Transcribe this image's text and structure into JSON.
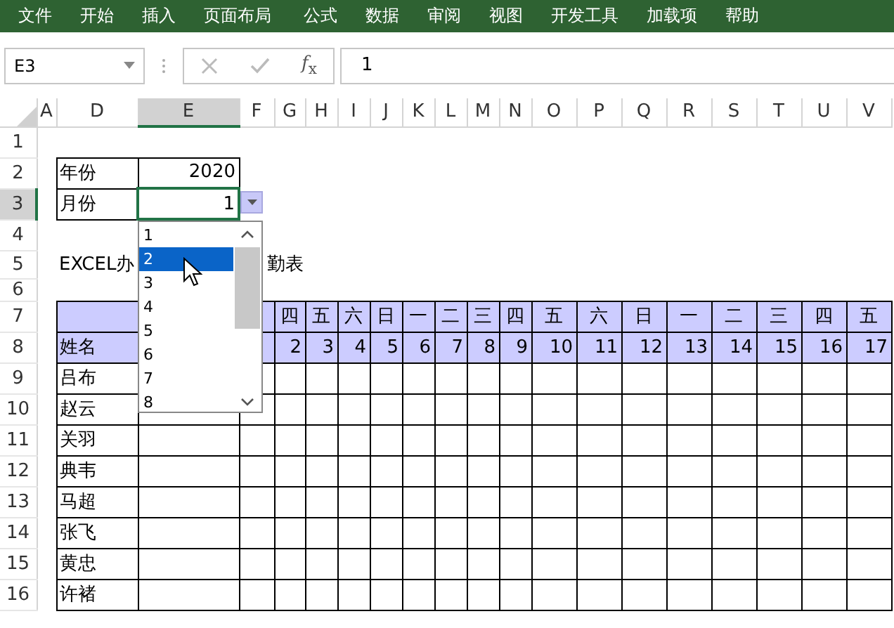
{
  "menu": [
    "文件",
    "开始",
    "插入",
    "页面布局",
    "公式",
    "数据",
    "审阅",
    "视图",
    "开发工具",
    "加载项",
    "帮助"
  ],
  "name_box": "E3",
  "fx_label": "*f*$_{x}$",
  "formula": "1",
  "columns": [
    {
      "label": "A",
      "selected": false
    },
    {
      "label": "D",
      "selected": false
    },
    {
      "label": "E",
      "selected": true
    },
    {
      "label": "F",
      "selected": false
    },
    {
      "label": "G",
      "selected": false
    },
    {
      "label": "H",
      "selected": false
    },
    {
      "label": "I",
      "selected": false
    },
    {
      "label": "J",
      "selected": false
    },
    {
      "label": "K",
      "selected": false
    },
    {
      "label": "L",
      "selected": false
    },
    {
      "label": "M",
      "selected": false
    },
    {
      "label": "N",
      "selected": false
    },
    {
      "label": "O",
      "selected": false
    },
    {
      "label": "P",
      "selected": false
    },
    {
      "label": "Q",
      "selected": false
    },
    {
      "label": "R",
      "selected": false
    },
    {
      "label": "S",
      "selected": false
    },
    {
      "label": "T",
      "selected": false
    },
    {
      "label": "U",
      "selected": false
    },
    {
      "label": "V",
      "selected": false
    }
  ],
  "rows": [
    {
      "label": "1",
      "selected": false
    },
    {
      "label": "2",
      "selected": false
    },
    {
      "label": "3",
      "selected": true
    },
    {
      "label": "4",
      "selected": false
    },
    {
      "label": "5",
      "selected": false
    },
    {
      "label": "6",
      "selected": false
    },
    {
      "label": "7",
      "selected": false
    },
    {
      "label": "8",
      "selected": false
    },
    {
      "label": "9",
      "selected": false
    },
    {
      "label": "10",
      "selected": false
    },
    {
      "label": "11",
      "selected": false
    },
    {
      "label": "12",
      "selected": false
    },
    {
      "label": "13",
      "selected": false
    },
    {
      "label": "14",
      "selected": false
    },
    {
      "label": "15",
      "selected": false
    },
    {
      "label": "16",
      "selected": false
    }
  ],
  "year_label": "年份",
  "year": "2020",
  "month_label": "月份",
  "month": "1",
  "title_parts": [
    "EXCEL办",
    "勤表"
  ],
  "weekdays": [
    "四",
    "五",
    "六",
    "日",
    "一",
    "二",
    "三",
    "四",
    "五",
    "六",
    "日",
    "一",
    "二",
    "三",
    "四",
    "五"
  ],
  "dates": [
    "2",
    "3",
    "4",
    "5",
    "6",
    "7",
    "8",
    "9",
    "10",
    "11",
    "12",
    "13",
    "14",
    "15",
    "16",
    "17"
  ],
  "name_header": "姓名",
  "names": [
    "吕布",
    "赵云",
    "关羽",
    "典韦",
    "马超",
    "张飞",
    "黄忠",
    "许褚"
  ],
  "dropdown": {
    "items": [
      {
        "label": "1",
        "selected": false
      },
      {
        "label": "2",
        "selected": true
      },
      {
        "label": "3",
        "selected": false
      },
      {
        "label": "4",
        "selected": false
      },
      {
        "label": "5",
        "selected": false
      },
      {
        "label": "6",
        "selected": false
      },
      {
        "label": "7",
        "selected": false
      },
      {
        "label": "8",
        "selected": false
      }
    ]
  }
}
